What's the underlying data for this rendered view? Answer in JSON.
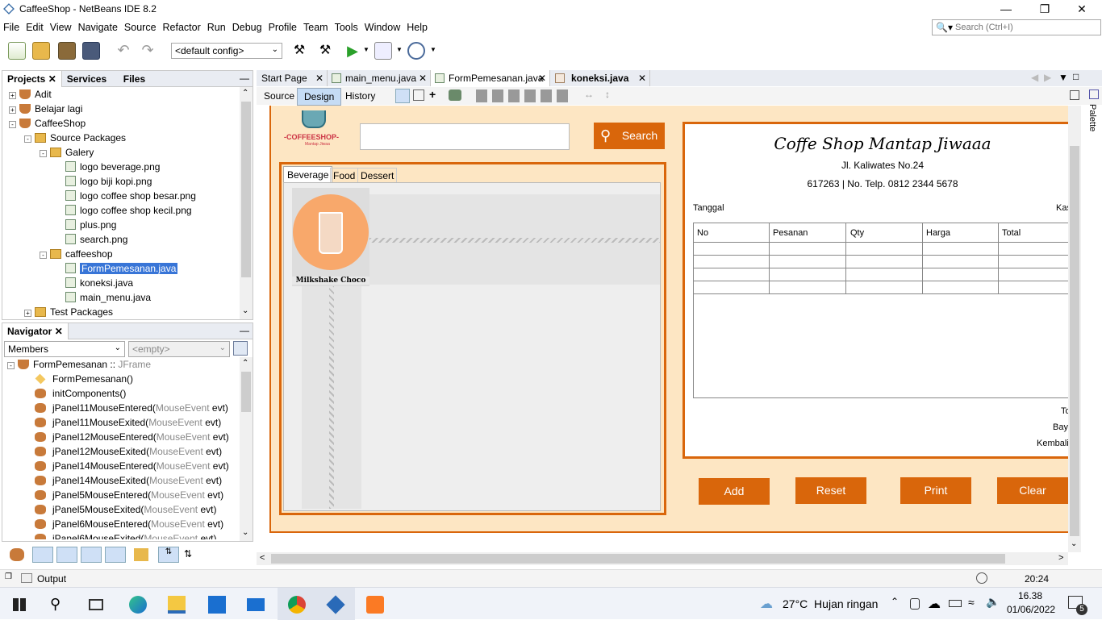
{
  "window": {
    "title": "CaffeeShop - NetBeans IDE 8.2"
  },
  "menu": [
    "File",
    "Edit",
    "View",
    "Navigate",
    "Source",
    "Refactor",
    "Run",
    "Debug",
    "Profile",
    "Team",
    "Tools",
    "Window",
    "Help"
  ],
  "search": {
    "placeholder": "Search (Ctrl+I)"
  },
  "toolbar": {
    "config": "<default config>"
  },
  "projects_panel": {
    "tabs": [
      "Projects",
      "Services",
      "Files"
    ],
    "tree": [
      {
        "label": "Adit",
        "depth": 0,
        "kind": "project",
        "exp": "+"
      },
      {
        "label": "Belajar lagi",
        "depth": 0,
        "kind": "project",
        "exp": "+"
      },
      {
        "label": "CaffeeShop",
        "depth": 0,
        "kind": "project",
        "exp": "-"
      },
      {
        "label": "Source Packages",
        "depth": 1,
        "kind": "folder",
        "exp": "-"
      },
      {
        "label": "Galery",
        "depth": 2,
        "kind": "folder",
        "exp": "-"
      },
      {
        "label": "logo beverage.png",
        "depth": 3,
        "kind": "file"
      },
      {
        "label": "logo biji kopi.png",
        "depth": 3,
        "kind": "file"
      },
      {
        "label": "logo coffee shop besar.png",
        "depth": 3,
        "kind": "file"
      },
      {
        "label": "logo coffee shop kecil.png",
        "depth": 3,
        "kind": "file"
      },
      {
        "label": "plus.png",
        "depth": 3,
        "kind": "file"
      },
      {
        "label": "search.png",
        "depth": 3,
        "kind": "file"
      },
      {
        "label": "caffeeshop",
        "depth": 2,
        "kind": "folder",
        "exp": "-"
      },
      {
        "label": "FormPemesanan.java",
        "depth": 3,
        "kind": "file",
        "selected": true
      },
      {
        "label": "koneksi.java",
        "depth": 3,
        "kind": "file"
      },
      {
        "label": "main_menu.java",
        "depth": 3,
        "kind": "file"
      },
      {
        "label": "Test Packages",
        "depth": 1,
        "kind": "folder",
        "exp": "+"
      }
    ]
  },
  "navigator": {
    "title": "Navigator",
    "members_label": "Members",
    "empty_label": "<empty>",
    "root": "FormPemesanan :: ",
    "root_type": "JFrame",
    "items": [
      {
        "name": "FormPemesanan()",
        "arg": "",
        "tail": ""
      },
      {
        "name": "initComponents()",
        "arg": "",
        "tail": ""
      },
      {
        "name": "jPanel11MouseEntered(",
        "arg": "MouseEvent",
        "tail": " evt)"
      },
      {
        "name": "jPanel11MouseExited(",
        "arg": "MouseEvent",
        "tail": " evt)"
      },
      {
        "name": "jPanel12MouseEntered(",
        "arg": "MouseEvent",
        "tail": " evt)"
      },
      {
        "name": "jPanel12MouseExited(",
        "arg": "MouseEvent",
        "tail": " evt)"
      },
      {
        "name": "jPanel14MouseEntered(",
        "arg": "MouseEvent",
        "tail": " evt)"
      },
      {
        "name": "jPanel14MouseExited(",
        "arg": "MouseEvent",
        "tail": " evt)"
      },
      {
        "name": "jPanel5MouseEntered(",
        "arg": "MouseEvent",
        "tail": " evt)"
      },
      {
        "name": "jPanel5MouseExited(",
        "arg": "MouseEvent",
        "tail": " evt)"
      },
      {
        "name": "jPanel6MouseEntered(",
        "arg": "MouseEvent",
        "tail": " evt)"
      },
      {
        "name": "jPanel6MouseExited(",
        "arg": "MouseEvent",
        "tail": " evt)"
      }
    ]
  },
  "editor": {
    "tabs": [
      "Start Page",
      "main_menu.java",
      "FormPemesanan.java",
      "koneksi.java"
    ],
    "active_tab": 2,
    "modes": [
      "Source",
      "Design",
      "History"
    ],
    "active_mode": 1
  },
  "form": {
    "logo_text": "-COFFEESHOP-",
    "logo_sub": "Mantap Jiwaa",
    "search_button": "Search",
    "category_tabs": [
      "Beverage",
      "Food",
      "Dessert"
    ],
    "product_name": "Milkshake Choco",
    "receipt": {
      "title": "Coffe Shop Mantap Jiwaaa",
      "address": "Jl. Kaliwates No.24",
      "phone": "617263 | No. Telp. 0812 2344 5678",
      "date_label": "Tanggal",
      "cashier_label": "Kas",
      "columns": [
        "No",
        "Pesanan",
        "Qty",
        "Harga",
        "Total"
      ],
      "total_label": "Tot",
      "pay_label": "Baya",
      "change_label": "Kembalia"
    },
    "buttons": [
      "Add",
      "Reset",
      "Print",
      "Clear"
    ]
  },
  "statusbar": {
    "output": "Output",
    "position": "20:24"
  },
  "taskbar": {
    "weather": "27°C  Hujan ringan",
    "time": "16.38",
    "date": "01/06/2022",
    "notif": "5"
  },
  "colors": {
    "accent": "#d9660b",
    "form_bg": "#fde6c3",
    "selection": "#3875d7"
  }
}
